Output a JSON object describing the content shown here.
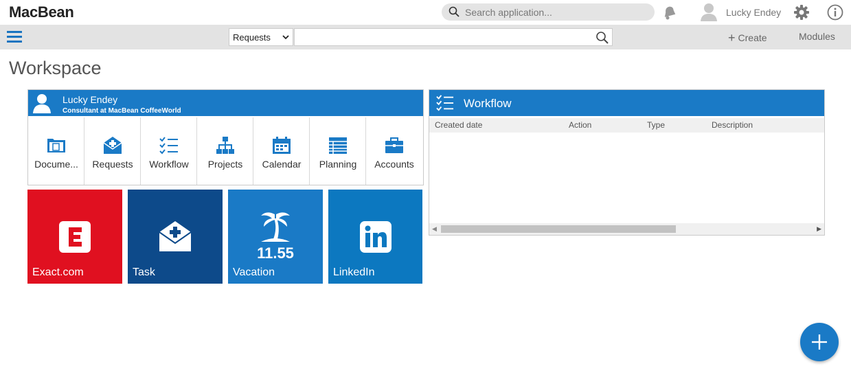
{
  "app": {
    "brand": "MacBean"
  },
  "topbar": {
    "search_placeholder": "Search application...",
    "user_name": "Lucky Endey"
  },
  "navbar": {
    "select_value": "Requests",
    "create_label": "Create",
    "modules_label": "Modules"
  },
  "page": {
    "title": "Workspace"
  },
  "profile": {
    "name": "Lucky Endey",
    "role": "Consultant at MacBean CoffeeWorld",
    "quick_links": [
      {
        "label": "Docume...",
        "icon": "document-folder-icon"
      },
      {
        "label": "Requests",
        "icon": "request-envelope-icon"
      },
      {
        "label": "Workflow",
        "icon": "checklist-icon"
      },
      {
        "label": "Projects",
        "icon": "org-chart-icon"
      },
      {
        "label": "Calendar",
        "icon": "calendar-icon"
      },
      {
        "label": "Planning",
        "icon": "planning-grid-icon"
      },
      {
        "label": "Accounts",
        "icon": "briefcase-icon"
      }
    ]
  },
  "tiles": [
    {
      "label": "Exact.com",
      "color": "#e01020",
      "icon": "exact-logo-icon"
    },
    {
      "label": "Task",
      "color": "#0d4a8a",
      "icon": "task-envelope-icon"
    },
    {
      "label": "Vacation",
      "color": "#1a7ac6",
      "icon": "palm-tree-icon",
      "value": "11.55"
    },
    {
      "label": "LinkedIn",
      "color": "#0c78c0",
      "icon": "linkedin-icon"
    }
  ],
  "workflow": {
    "title": "Workflow",
    "columns": [
      "Created date",
      "Action",
      "Type",
      "Description"
    ]
  },
  "colors": {
    "accent": "#1a7ac6",
    "navbar": "#e3e3e3"
  }
}
